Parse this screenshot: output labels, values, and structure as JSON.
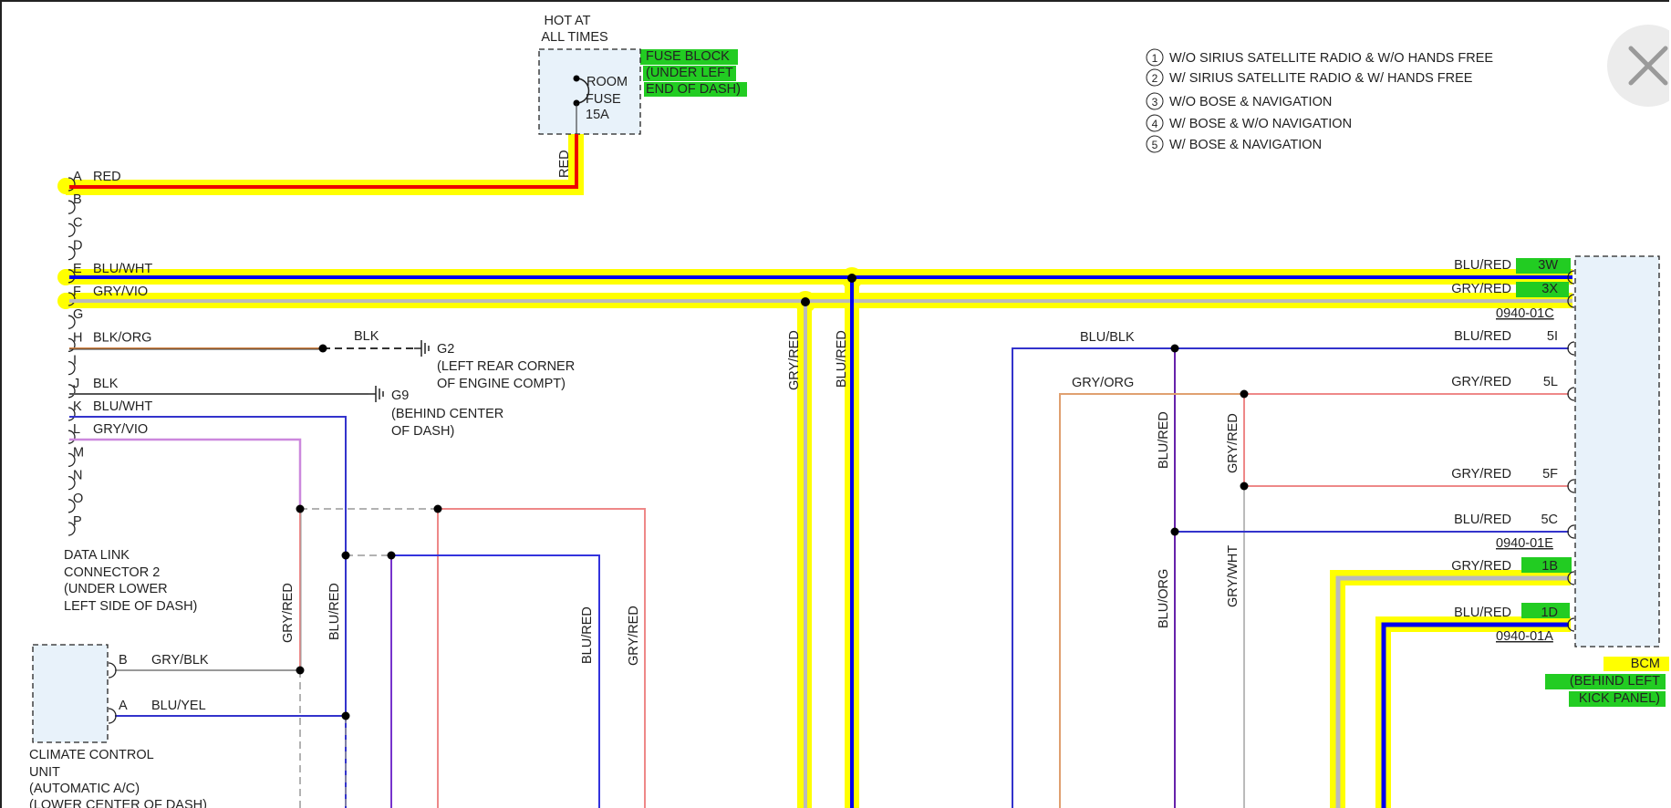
{
  "hot_label": [
    "HOT AT",
    "ALL TIMES"
  ],
  "fuse_label": [
    "ROOM",
    "FUSE",
    "15A"
  ],
  "fuse_block_label": [
    "FUSE BLOCK",
    "(UNDER LEFT",
    "END OF DASH)"
  ],
  "fuse_wire": "RED",
  "notes": [
    {
      "num": "1",
      "text": "W/O SIRIUS SATELLITE RADIO & W/O HANDS FREE"
    },
    {
      "num": "2",
      "text": "W/ SIRIUS SATELLITE RADIO & W/ HANDS FREE"
    },
    {
      "num": "3",
      "text": "W/O BOSE & NAVIGATION"
    },
    {
      "num": "4",
      "text": "W/ BOSE & W/O NAVIGATION"
    },
    {
      "num": "5",
      "text": "W/ BOSE & NAVIGATION"
    }
  ],
  "dlc_pins": [
    {
      "pin": "A",
      "wire": "RED"
    },
    {
      "pin": "B",
      "wire": ""
    },
    {
      "pin": "C",
      "wire": ""
    },
    {
      "pin": "D",
      "wire": ""
    },
    {
      "pin": "E",
      "wire": "BLU/WHT"
    },
    {
      "pin": "F",
      "wire": "GRY/VIO"
    },
    {
      "pin": "G",
      "wire": ""
    },
    {
      "pin": "H",
      "wire": "BLK/ORG"
    },
    {
      "pin": "I",
      "wire": ""
    },
    {
      "pin": "J",
      "wire": "BLK"
    },
    {
      "pin": "K",
      "wire": "BLU/WHT"
    },
    {
      "pin": "L",
      "wire": "GRY/VIO"
    },
    {
      "pin": "M",
      "wire": ""
    },
    {
      "pin": "N",
      "wire": ""
    },
    {
      "pin": "O",
      "wire": ""
    },
    {
      "pin": "P",
      "wire": ""
    }
  ],
  "dlc_label": [
    "DATA LINK",
    "CONNECTOR 2",
    "(UNDER LOWER",
    "LEFT SIDE OF DASH)"
  ],
  "ground_wire": "BLK",
  "g2": {
    "id": "G2",
    "desc": [
      "(LEFT REAR CORNER",
      "OF ENGINE COMPT)"
    ]
  },
  "g9": {
    "id": "G9",
    "desc": [
      "(BEHIND CENTER",
      "OF DASH)"
    ]
  },
  "ccu_pins": [
    {
      "pin": "B",
      "wire": "GRY/BLK"
    },
    {
      "pin": "A",
      "wire": "BLU/YEL"
    }
  ],
  "ccu_label": [
    "CLIMATE CONTROL",
    "UNIT",
    "(AUTOMATIC A/C)",
    "(LOWER CENTER OF DASH)"
  ],
  "vertical_labels": {
    "left_gry": "GRY/RED",
    "left_blu": "BLU/RED",
    "mid_blu": "BLU/RED",
    "mid_gry": "GRY/RED",
    "trunk_gry": "GRY/RED",
    "trunk_blu": "BLU/RED",
    "r_blu_red": "BLU/RED",
    "r_gry_red": "GRY/RED",
    "r_blu_org": "BLU/ORG",
    "r_gry_wht": "GRY/WHT"
  },
  "mid_wires": {
    "blu_blk": "BLU/BLK",
    "gry_org": "GRY/ORG"
  },
  "bcm_pins": [
    {
      "wire": "BLU/RED",
      "pin": "3W"
    },
    {
      "wire": "GRY/RED",
      "pin": "3X"
    },
    {
      "wire": "BLU/RED",
      "pin": "5I"
    },
    {
      "wire": "GRY/RED",
      "pin": "5L"
    },
    {
      "wire": "GRY/RED",
      "pin": "5F"
    },
    {
      "wire": "BLU/RED",
      "pin": "5C"
    },
    {
      "wire": "GRY/RED",
      "pin": "1B"
    },
    {
      "wire": "BLU/RED",
      "pin": "1D"
    }
  ],
  "connector_ids": [
    "0940-01C",
    "0940-01E",
    "0940-01A"
  ],
  "bcm_label": [
    "BCM",
    "(BEHIND LEFT",
    "KICK PANEL)"
  ],
  "close_icon": "close-icon",
  "colors": {
    "highlight_yellow": "#ffff00",
    "highlight_green": "#22cc22",
    "wire_blue": "#0000ee",
    "wire_red": "#ee0000",
    "wire_gray": "#bbbbbb",
    "module_fill": "#e8f2fa"
  }
}
